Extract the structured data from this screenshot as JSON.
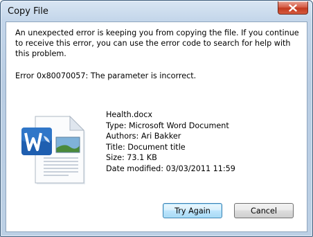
{
  "window": {
    "title": "Copy File"
  },
  "message": "An unexpected error is keeping you from copying the file. If you continue to receive this error, you can use the error code to search for help with this problem.",
  "error_line": "Error 0x80070057: The parameter is incorrect.",
  "file": {
    "icon": "word-document-icon",
    "name": "Health.docx",
    "type": "Type: Microsoft Word Document",
    "authors": "Authors: Ari Bakker",
    "title": "Title: Document title",
    "size": "Size: 73.1 KB",
    "modified": "Date modified: 03/03/2011 11:59"
  },
  "buttons": {
    "try_again": "Try Again",
    "cancel": "Cancel"
  },
  "colors": {
    "close_button": "#c2391f",
    "frame": "#c4d6ea"
  }
}
